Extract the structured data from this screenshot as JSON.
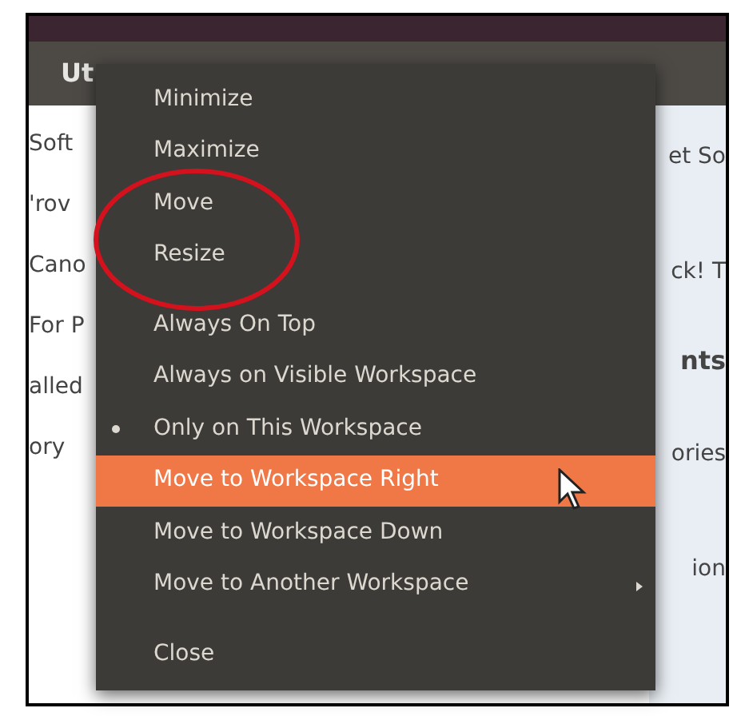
{
  "window": {
    "title": "Ut"
  },
  "background": {
    "left_texts": [
      "Soft",
      "'rov",
      "Cano",
      "For P",
      "alled",
      "ory"
    ],
    "right_texts": [
      "et So",
      "ck! T",
      "nts",
      "ories",
      "ion"
    ]
  },
  "menu": {
    "items": [
      {
        "kind": "item",
        "label": "Minimize",
        "selected": false,
        "checked": false,
        "submenu": false
      },
      {
        "kind": "item",
        "label": "Maximize",
        "selected": false,
        "checked": false,
        "submenu": false
      },
      {
        "kind": "item",
        "label": "Move",
        "selected": false,
        "checked": false,
        "submenu": false
      },
      {
        "kind": "item",
        "label": "Resize",
        "selected": false,
        "checked": false,
        "submenu": false
      },
      {
        "kind": "separator"
      },
      {
        "kind": "item",
        "label": "Always On Top",
        "selected": false,
        "checked": false,
        "submenu": false
      },
      {
        "kind": "item",
        "label": "Always on Visible Workspace",
        "selected": false,
        "checked": false,
        "submenu": false
      },
      {
        "kind": "item",
        "label": "Only on This Workspace",
        "selected": false,
        "checked": true,
        "submenu": false
      },
      {
        "kind": "item",
        "label": "Move to Workspace Right",
        "selected": true,
        "checked": false,
        "submenu": false
      },
      {
        "kind": "item",
        "label": "Move to Workspace Down",
        "selected": false,
        "checked": false,
        "submenu": false
      },
      {
        "kind": "item",
        "label": "Move to Another Workspace",
        "selected": false,
        "checked": false,
        "submenu": true
      },
      {
        "kind": "separator"
      },
      {
        "kind": "item",
        "label": "Close",
        "selected": false,
        "checked": false,
        "submenu": false
      }
    ]
  }
}
